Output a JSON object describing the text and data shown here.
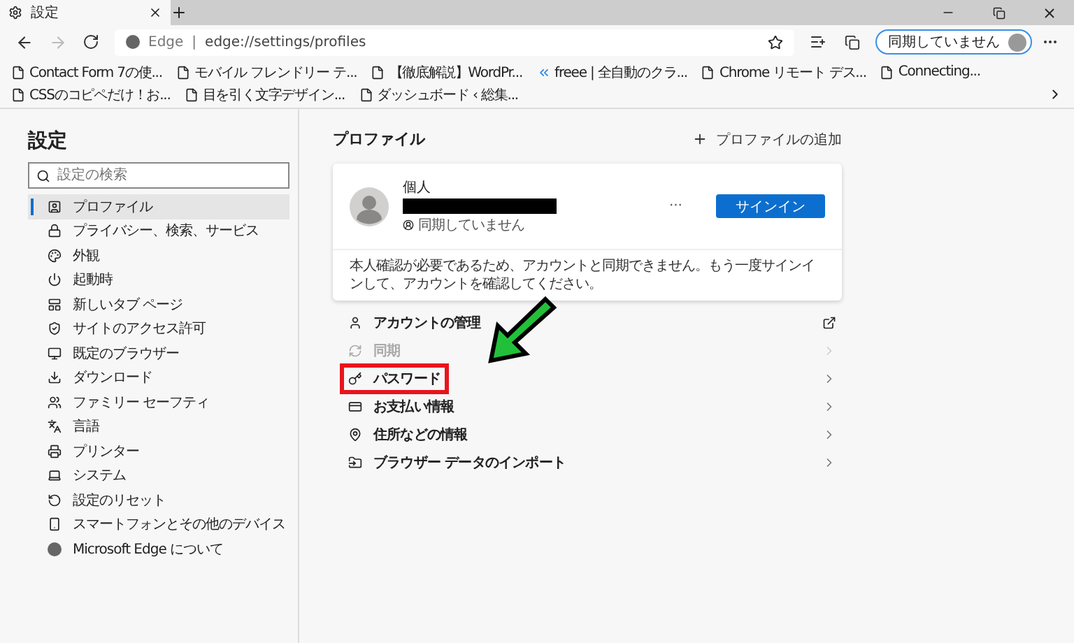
{
  "tab_bar": {
    "tabs": [
      {
        "title": "設定",
        "selected": true
      }
    ]
  },
  "address_bar": {
    "site_label": "Edge",
    "separator": "|",
    "url": "edge://settings/profiles",
    "sync_button": "同期していません"
  },
  "bookmarks": [
    {
      "label": "Contact Form 7の使...",
      "kind": "page"
    },
    {
      "label": "モバイル フレンドリー テ...",
      "kind": "page"
    },
    {
      "label": "【徹底解説】WordPr...",
      "kind": "page"
    },
    {
      "label": "freee | 全自動のクラ...",
      "kind": "app"
    },
    {
      "label": "Chrome リモート デス...",
      "kind": "page"
    },
    {
      "label": "Connecting...",
      "kind": "page"
    },
    {
      "label": "CSSのコピペだけ！お...",
      "kind": "page"
    },
    {
      "label": "目を引く文字デザイン...",
      "kind": "page"
    },
    {
      "label": "ダッシュボード ‹ 総集...",
      "kind": "page"
    }
  ],
  "sidebar": {
    "title": "設定",
    "search": {
      "placeholder": "設定の検索"
    },
    "items": [
      {
        "label": "プロファイル",
        "selected": true
      },
      {
        "label": "プライバシー、検索、サービス",
        "selected": false
      },
      {
        "label": "外観",
        "selected": false
      },
      {
        "label": "起動時",
        "selected": false
      },
      {
        "label": "新しいタブ ページ",
        "selected": false
      },
      {
        "label": "サイトのアクセス許可",
        "selected": false
      },
      {
        "label": "既定のブラウザー",
        "selected": false
      },
      {
        "label": "ダウンロード",
        "selected": false
      },
      {
        "label": "ファミリー セーフティ",
        "selected": false
      },
      {
        "label": "言語",
        "selected": false
      },
      {
        "label": "プリンター",
        "selected": false
      },
      {
        "label": "システム",
        "selected": false
      },
      {
        "label": "設定のリセット",
        "selected": false
      },
      {
        "label": "スマートフォンとその他のデバイス",
        "selected": false
      },
      {
        "label": "Microsoft Edge について",
        "selected": false
      }
    ]
  },
  "profiles": {
    "title": "プロファイル",
    "add_button": "プロファイルの追加",
    "card": {
      "name": "個人",
      "redacted": true,
      "sync_status": "同期していません",
      "more": "···",
      "sign_in_button": "サインイン",
      "note": "本人確認が必要であるため、アカウントと同期できません。もう一度サインインして、アカウントを確認してください。"
    },
    "rows": [
      {
        "label": "アカウントの管理",
        "kind": "external",
        "disabled": false,
        "highlighted": false
      },
      {
        "label": "同期",
        "kind": "link",
        "disabled": true,
        "highlighted": false
      },
      {
        "label": "パスワード",
        "kind": "link",
        "disabled": false,
        "highlighted": true
      },
      {
        "label": "お支払い情報",
        "kind": "link",
        "disabled": false,
        "highlighted": false
      },
      {
        "label": "住所などの情報",
        "kind": "link",
        "disabled": false,
        "highlighted": false
      },
      {
        "label": "ブラウザー データのインポート",
        "kind": "link",
        "disabled": false,
        "highlighted": false
      }
    ]
  }
}
